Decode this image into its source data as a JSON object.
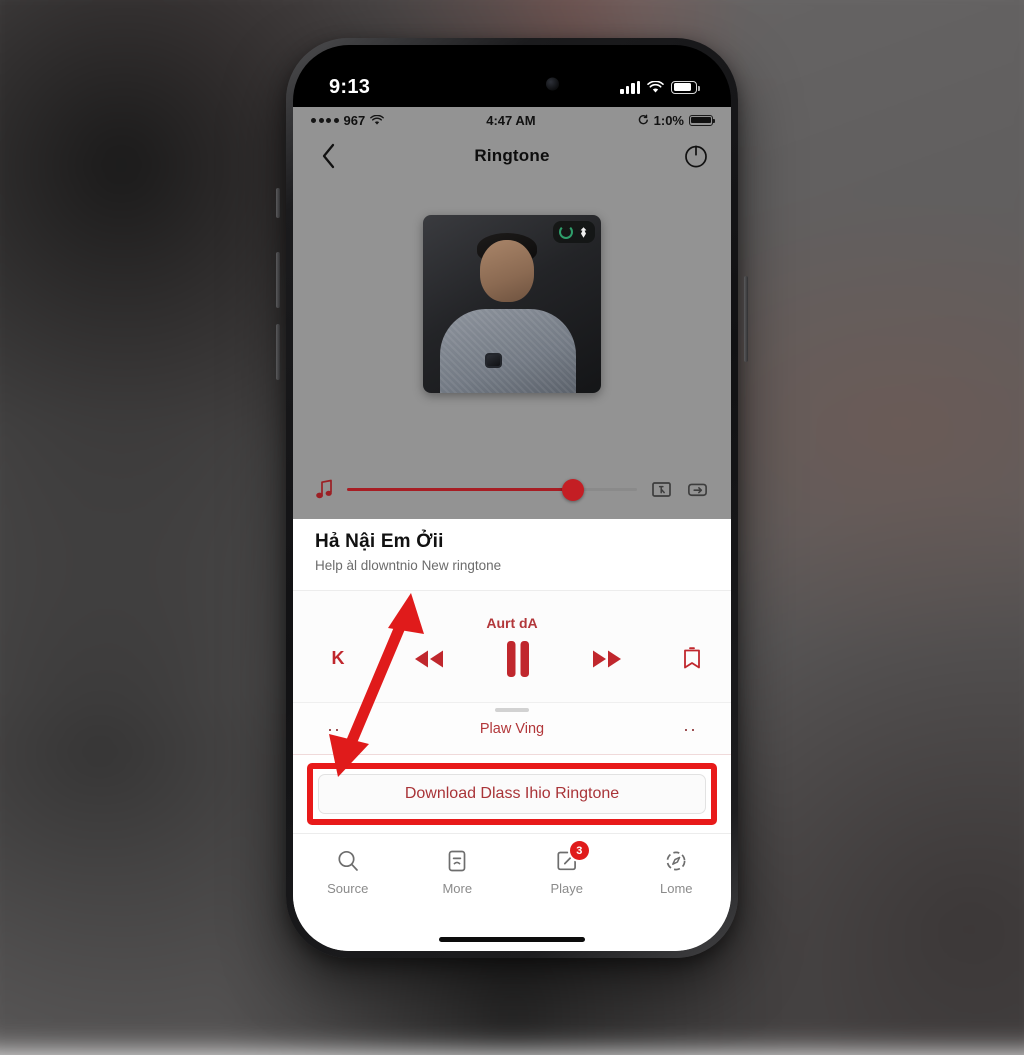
{
  "os_status": {
    "clock": "9:13",
    "signal_icon": "cellular-bars-icon",
    "wifi_icon": "wifi-icon",
    "battery_icon": "battery-icon"
  },
  "app_status": {
    "carrier_dots": "••••",
    "carrier": "967",
    "wifi_icon": "wifi-icon",
    "time": "4:47 AM",
    "orientation_lock_icon": "rotation-lock-icon",
    "battery_percent": "1:0%",
    "battery_icon": "battery-icon"
  },
  "navbar": {
    "back_icon": "chevron-left-icon",
    "title": "Ringtone",
    "power_icon": "power-icon"
  },
  "artwork": {
    "alt": "album-artwork-person",
    "badge_ring_icon": "recording-ring-icon",
    "badge_bird_icon": "bird-icon"
  },
  "slider": {
    "music_icon": "music-note-icon",
    "progress_percent": 78,
    "cut_icon": "cut-marker-icon",
    "loop_icon": "loop-icon",
    "track_color": "#a71d23",
    "knob_color": "#c41e24"
  },
  "track": {
    "title": "Hả Nậi Em Ởii",
    "subtitle": "Help àl dlowntnio New ringtone"
  },
  "controls": {
    "label": "Aurt dA",
    "skip_prev_label": "K",
    "rewind_icon": "rewind-icon",
    "pause_icon": "pause-icon",
    "forward_icon": "fast-forward-icon",
    "bookmark_icon": "bookmark-icon",
    "accent_color": "#c0272d"
  },
  "now_playing": {
    "label": "Plaw Ving",
    "left_dots": "··",
    "right_dots": "··"
  },
  "download": {
    "label": "Download Dlass Ihio Ringtone",
    "highlight_color": "#e81a1a"
  },
  "tabbar": {
    "items": [
      {
        "label": "Source",
        "icon": "search-icon",
        "badge": ""
      },
      {
        "label": "More",
        "icon": "document-icon",
        "badge": ""
      },
      {
        "label": "Playe",
        "icon": "share-icon",
        "badge": "3"
      },
      {
        "label": "Lome",
        "icon": "compass-icon",
        "badge": ""
      }
    ]
  },
  "annotation": {
    "arrow": "double-headed-red-arrow",
    "color": "#e01b1b"
  }
}
